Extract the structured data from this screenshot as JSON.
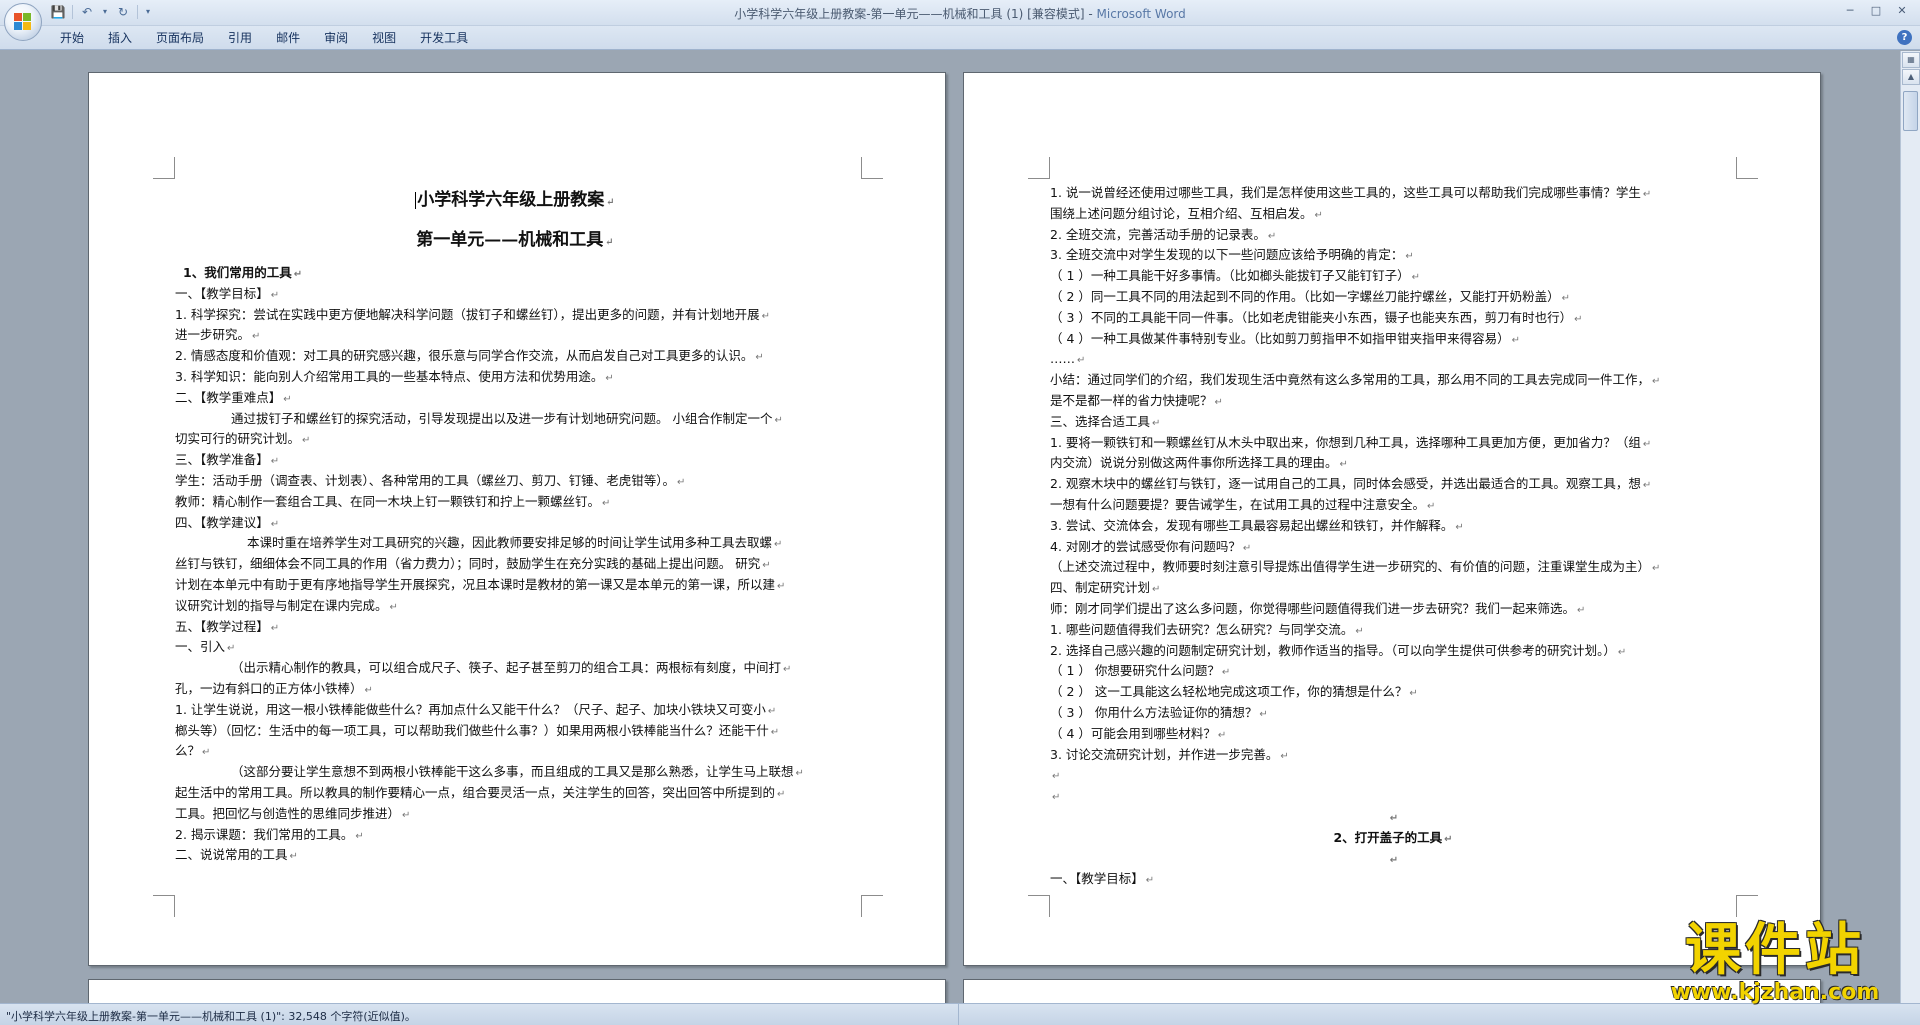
{
  "window": {
    "title_doc": "小学科学六年级上册教案-第一单元——机械和工具 (1) [兼容模式]",
    "title_sep": " - ",
    "title_app": "Microsoft Word"
  },
  "qat": {
    "save_icon": "save-icon",
    "undo_icon": "undo-icon",
    "redo_icon": "redo-icon",
    "customize_icon": "customize-qat-icon"
  },
  "ribbon": {
    "tabs": [
      {
        "label": "开始"
      },
      {
        "label": "插入"
      },
      {
        "label": "页面布局"
      },
      {
        "label": "引用"
      },
      {
        "label": "邮件"
      },
      {
        "label": "审阅"
      },
      {
        "label": "视图"
      },
      {
        "label": "开发工具"
      }
    ]
  },
  "page1": {
    "title": "小学科学六年级上册教案",
    "subtitle": "第一单元——机械和工具",
    "lines": [
      {
        "t": "1、我们常用的工具",
        "cls": "bold",
        "pad": "s1"
      },
      {
        "t": "一、【教学目标】"
      },
      {
        "t": "1. 科学探究：尝试在实践中更方便地解决科学问题（拔钉子和螺丝钉），提出更多的问题，并有计划地开展"
      },
      {
        "t": "进一步研究。"
      },
      {
        "t": "2. 情感态度和价值观：对工具的研究感兴趣，很乐意与同学合作交流，从而启发自己对工具更多的认识。"
      },
      {
        "t": "3. 科学知识：能向别人介绍常用工具的一些基本特点、使用方法和优势用途。"
      },
      {
        "t": "二、【教学重难点】"
      },
      {
        "t": "通过拔钉子和螺丝钉的探究活动，引导发现提出以及进一步有计划地研究问题。 小组合作制定一个",
        "cls": "indent"
      },
      {
        "t": "切实可行的研究计划。"
      },
      {
        "t": "三、【教学准备】"
      },
      {
        "t": "学生：活动手册（调查表、计划表）、各种常用的工具（螺丝刀、剪刀、钉锤、老虎钳等）。"
      },
      {
        "t": "教师：精心制作一套组合工具、在同一木块上钉一颗铁钉和拧上一颗螺丝钉。"
      },
      {
        "t": "四、【教学建议】"
      },
      {
        "t": "本课时重在培养学生对工具研究的兴趣，因此教师要安排足够的时间让学生试用多种工具去取螺",
        "cls": "indent2"
      },
      {
        "t": "丝钉与铁钉，细细体会不同工具的作用（省力费力）；同时，鼓励学生在充分实践的基础上提出问题。 研究"
      },
      {
        "t": "计划在本单元中有助于更有序地指导学生开展探究，况且本课时是教材的第一课又是本单元的第一课，所以建"
      },
      {
        "t": "议研究计划的指导与制定在课内完成。"
      },
      {
        "t": "五、【教学过程】"
      },
      {
        "t": "一、引入"
      },
      {
        "t": "（出示精心制作的教具，可以组合成尺子、筷子、起子甚至剪刀的组合工具：两根标有刻度，中间打",
        "cls": "indent"
      },
      {
        "t": "孔，一边有斜口的正方体小铁棒）"
      },
      {
        "t": "1. 让学生说说，用这一根小铁棒能做些什么？再加点什么又能干什么？（尺子、起子、加块小铁块又可变小"
      },
      {
        "t": "榔头等）（回忆：生活中的每一项工具，可以帮助我们做些什么事？）如果用两根小铁棒能当什么？还能干什"
      },
      {
        "t": "么？"
      },
      {
        "t": "（这部分要让学生意想不到两根小铁棒能干这么多事，而且组成的工具又是那么熟悉，让学生马上联想",
        "cls": "indent"
      },
      {
        "t": "起生活中的常用工具。所以教具的制作要精心一点，组合要灵活一点，关注学生的回答，突出回答中所提到的"
      },
      {
        "t": "工具。把回忆与创造性的思维同步推进）"
      },
      {
        "t": "2. 揭示课题：我们常用的工具。"
      },
      {
        "t": "二、说说常用的工具"
      }
    ]
  },
  "page2": {
    "lines": [
      {
        "t": "1. 说一说曾经还使用过哪些工具，我们是怎样使用这些工具的，这些工具可以帮助我们完成哪些事情？学生"
      },
      {
        "t": "围绕上述问题分组讨论，互相介绍、互相启发。"
      },
      {
        "t": "2. 全班交流，完善活动手册的记录表。"
      },
      {
        "t": "3. 全班交流中对学生发现的以下一些问题应该给予明确的肯定："
      },
      {
        "t": "（ 1 ）一种工具能干好多事情。（比如榔头能拔钉子又能钉钉子）"
      },
      {
        "t": "（ 2 ）同一工具不同的用法起到不同的作用。（比如一字螺丝刀能拧螺丝，又能打开奶粉盖）"
      },
      {
        "t": "（ 3 ）不同的工具能干同一件事。（比如老虎钳能夹小东西，镊子也能夹东西，剪刀有时也行）"
      },
      {
        "t": "（ 4 ）一种工具做某件事特别专业。（比如剪刀剪指甲不如指甲钳夹指甲来得容易）"
      },
      {
        "t": "……"
      },
      {
        "t": "小结：通过同学们的介绍，我们发现生活中竟然有这么多常用的工具，那么用不同的工具去完成同一件工作，"
      },
      {
        "t": "是不是都一样的省力快捷呢？"
      },
      {
        "t": "三、选择合适工具"
      },
      {
        "t": "1. 要将一颗铁钉和一颗螺丝钉从木头中取出来，你想到几种工具，选择哪种工具更加方便，更加省力？（组"
      },
      {
        "t": "内交流）说说分别做这两件事你所选择工具的理由。"
      },
      {
        "t": "2. 观察木块中的螺丝钉与铁钉，逐一试用自己的工具，同时体会感受，并选出最适合的工具。观察工具，想"
      },
      {
        "t": "一想有什么问题要提？要告诫学生，在试用工具的过程中注意安全。"
      },
      {
        "t": "3. 尝试、交流体会，发现有哪些工具最容易起出螺丝和铁钉，并作解释。"
      },
      {
        "t": "4. 对刚才的尝试感受你有问题吗？"
      },
      {
        "t": "（上述交流过程中，教师要时刻注意引导提炼出值得学生进一步研究的、有价值的问题，注重课堂生成为主）"
      },
      {
        "t": "四、制定研究计划"
      },
      {
        "t": "师：刚才同学们提出了这么多问题，你觉得哪些问题值得我们进一步去研究？我们一起来筛选。"
      },
      {
        "t": "1. 哪些问题值得我们去研究？怎么研究？与同学交流。"
      },
      {
        "t": "2. 选择自己感兴趣的问题制定研究计划，教师作适当的指导。（可以向学生提供可供参考的研究计划。）"
      },
      {
        "t": "（ 1 ） 你想要研究什么问题？"
      },
      {
        "t": "（ 2 ） 这一工具能这么轻松地完成这项工作，你的猜想是什么？"
      },
      {
        "t": "（ 3 ） 你用什么方法验证你的猜想？"
      },
      {
        "t": "（ 4 ）可能会用到哪些材料？"
      },
      {
        "t": "3. 讨论交流研究计划，并作进一步完善。"
      },
      {
        "t": ""
      },
      {
        "t": ""
      },
      {
        "t": "",
        "cls": "center-b"
      },
      {
        "t": "2、打开盖子的工具",
        "cls": "center-b"
      },
      {
        "t": "",
        "cls": "center-b"
      },
      {
        "t": "一、【教学目标】"
      }
    ]
  },
  "paragraph_mark": "↵",
  "status": {
    "text": "\"小学科学六年级上册教案-第一单元——机械和工具 (1)\": 32,548 个字符(近似值)。"
  },
  "watermark": {
    "text": "课件站",
    "url": "www.kjzhan.com"
  },
  "colors": {
    "page_bg": "#9ba6b3",
    "ribbon": "#d3dfee",
    "watermark": "#f2d300"
  }
}
